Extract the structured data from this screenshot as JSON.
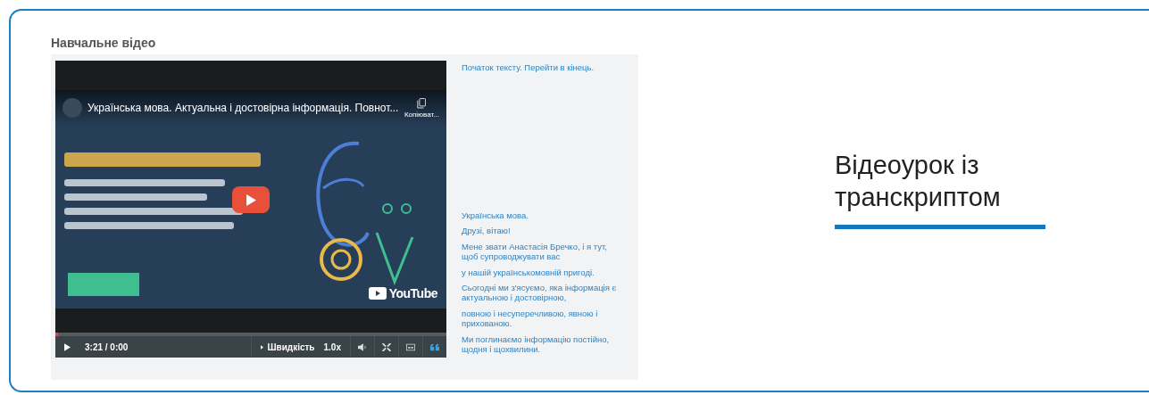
{
  "section_title": "Навчальне відео",
  "video": {
    "kind": "picture",
    "title": "Українська мова. Актуальна і достовірна інформація. Повнот...",
    "copy_label": "Копіюват...",
    "platform": "YouTube"
  },
  "player": {
    "time": "3:21 / 0:00",
    "speed_label": "Швидкість",
    "speed": "1.0x",
    "captions_on": true
  },
  "transcript": {
    "start_link": "Початок тексту. Перейти в кінець.",
    "lines": [
      "Українська мова.",
      "Друзі, вітаю!",
      "Мене звати Анастасія Бречко, і я тут, щоб супроводжувати вас",
      "у нашій українськомовній пригоді.",
      "Сьогодні ми з'ясуємо, яка інформація є актуальною і достовірною,",
      "повною і несуперечливою, явною і прихованою.",
      "Ми поглинаємо інформацію постійно, щодня і щохвилини."
    ]
  },
  "caption": {
    "title": "Відеоурок із транскриптом"
  }
}
